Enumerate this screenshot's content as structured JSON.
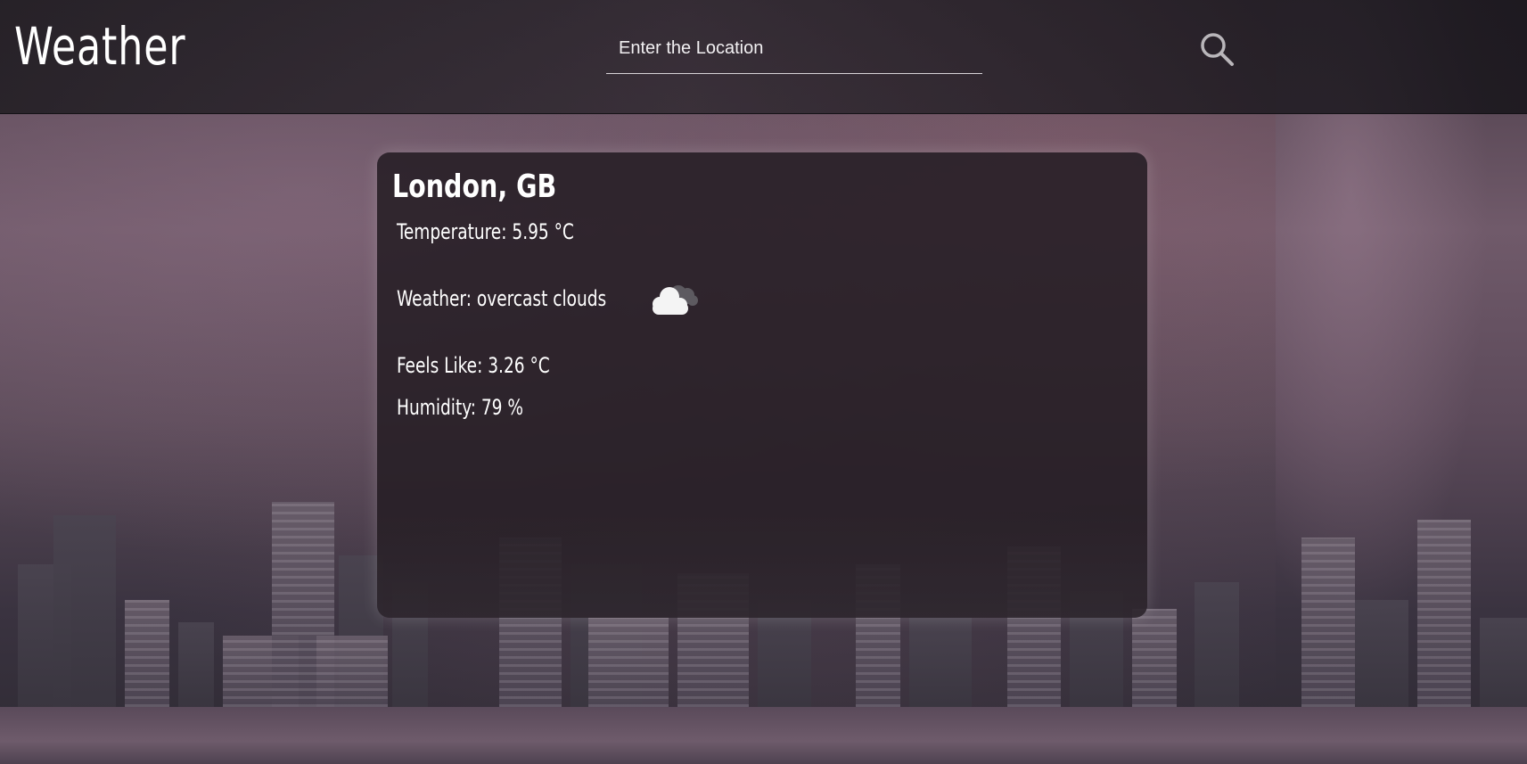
{
  "header": {
    "logo": "Weather",
    "search": {
      "placeholder": "Enter the Location",
      "value": ""
    },
    "search_icon": "search-icon"
  },
  "card": {
    "city": "London, GB",
    "temperature": "Temperature: 5.95 °C",
    "weather": "Weather: overcast clouds",
    "weather_icon": "overcast-clouds-icon",
    "feels_like": "Feels Like: 3.26 °C",
    "humidity": "Humidity: 79 %"
  },
  "colors": {
    "text": "#ffffff",
    "card_bg": "#261e24",
    "header_bg": "#1e1b20"
  }
}
